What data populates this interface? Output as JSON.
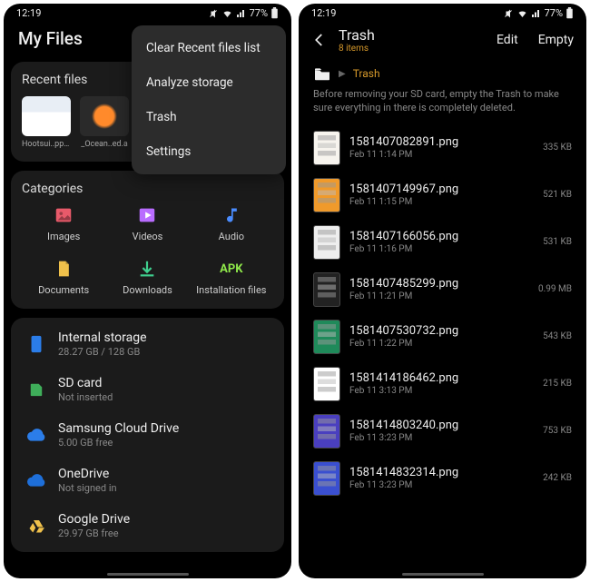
{
  "status": {
    "time": "12:19",
    "battery": "77%"
  },
  "left": {
    "title": "My Files",
    "recent_title": "Recent files",
    "recent": [
      {
        "name": "Hootsui..pp.jpg"
      },
      {
        "name": "_Ocean..ed.a"
      }
    ],
    "categories_title": "Categories",
    "categories": [
      {
        "label": "Images",
        "color": "#e85a6a"
      },
      {
        "label": "Videos",
        "color": "#b96cff"
      },
      {
        "label": "Audio",
        "color": "#4a8cff"
      },
      {
        "label": "Documents",
        "color": "#f0c14b"
      },
      {
        "label": "Downloads",
        "color": "#3fcf8e"
      },
      {
        "label": "Installation files",
        "color": "#8fe84a",
        "apk": "APK"
      }
    ],
    "storage": [
      {
        "name": "Internal storage",
        "sub": "28.27 GB / 128 GB",
        "color": "#2b7de9"
      },
      {
        "name": "SD card",
        "sub": "Not inserted",
        "color": "#3fae5a"
      },
      {
        "name": "Samsung Cloud Drive",
        "sub": "5.00 GB free",
        "color": "#2b7de9"
      },
      {
        "name": "OneDrive",
        "sub": "Not signed in",
        "color": "#1e6fd9"
      },
      {
        "name": "Google Drive",
        "sub": "29.97 GB free",
        "color": "#f0c14b"
      }
    ],
    "menu": [
      "Clear Recent files list",
      "Analyze storage",
      "Trash",
      "Settings"
    ]
  },
  "right": {
    "title": "Trash",
    "subtitle": "8 items",
    "edit": "Edit",
    "empty": "Empty",
    "crumb": "Trash",
    "note": "Before removing your SD card, empty the Trash to make sure everything in there is completely deleted.",
    "files": [
      {
        "name": "1581407082891.png",
        "date": "Feb 11 1:14 PM",
        "size": "335 KB",
        "tint": "#f7f4ee"
      },
      {
        "name": "1581407149967.png",
        "date": "Feb 11 1:15 PM",
        "size": "521 KB",
        "tint": "#f09a2b"
      },
      {
        "name": "1581407166056.png",
        "date": "Feb 11 1:16 PM",
        "size": "531 KB",
        "tint": "#eeeeee"
      },
      {
        "name": "1581407485299.png",
        "date": "Feb 11 1:21 PM",
        "size": "0.99 MB",
        "tint": "#222222"
      },
      {
        "name": "1581407530732.png",
        "date": "Feb 11 1:22 PM",
        "size": "543 KB",
        "tint": "#1f8a5a"
      },
      {
        "name": "1581414186462.png",
        "date": "Feb 11 3:13 PM",
        "size": "215 KB",
        "tint": "#ffffff"
      },
      {
        "name": "1581414803240.png",
        "date": "Feb 11 3:23 PM",
        "size": "753 KB",
        "tint": "#4a3fbf"
      },
      {
        "name": "1581414832314.png",
        "date": "Feb 11 3:23 PM",
        "size": "242 KB",
        "tint": "#3a4fd0"
      }
    ]
  }
}
